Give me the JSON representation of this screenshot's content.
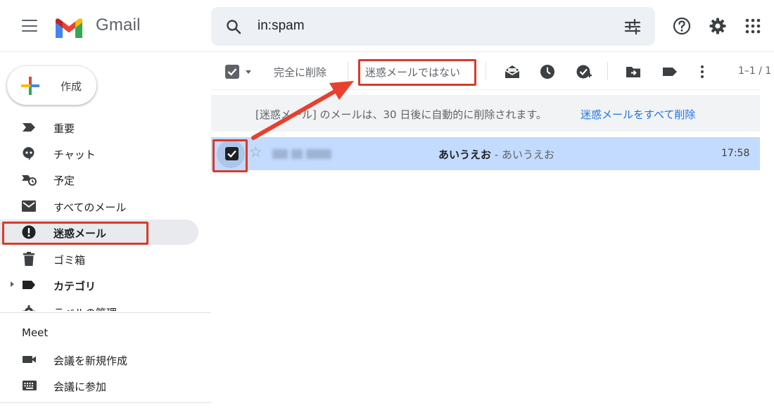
{
  "app": {
    "logo_text": "Gmail"
  },
  "search": {
    "value": "in:spam"
  },
  "compose": {
    "label": "作成"
  },
  "sidebar": {
    "items": [
      {
        "label": "重要",
        "icon": "label-important-icon"
      },
      {
        "label": "チャット",
        "icon": "chat-icon"
      },
      {
        "label": "予定",
        "icon": "scheduled-icon"
      },
      {
        "label": "すべてのメール",
        "icon": "mail-icon"
      },
      {
        "label": "迷惑メール",
        "icon": "spam-icon",
        "active": true
      },
      {
        "label": "ゴミ箱",
        "icon": "trash-icon"
      },
      {
        "label": "カテゴリ",
        "icon": "label-icon"
      },
      {
        "label": "ラベルの管理",
        "icon": "gear-icon"
      }
    ],
    "meet_title": "Meet",
    "meet_items": [
      {
        "label": "会議を新規作成",
        "icon": "videocam-icon"
      },
      {
        "label": "会議に参加",
        "icon": "keyboard-icon"
      }
    ]
  },
  "toolbar": {
    "delete_forever_label": "完全に削除",
    "not_spam_label": "迷惑メールではない",
    "pagination": "1–1 / 1"
  },
  "banner": {
    "message": "[迷惑メール] のメールは、30 日後に自動的に削除されます。",
    "link": "迷惑メールをすべて削除"
  },
  "email": {
    "subject": "あいうえお",
    "separator": " - ",
    "snippet": "あいうえお",
    "time": "17:58"
  },
  "colors": {
    "annotation": "#d83a2c",
    "selected_row": "#c2dbff",
    "link": "#1a73e8"
  }
}
